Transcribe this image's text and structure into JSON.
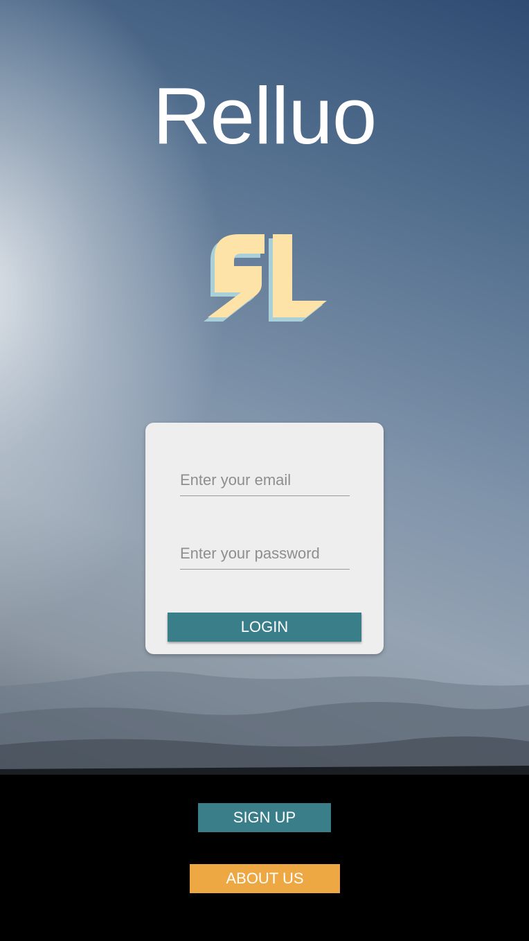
{
  "app": {
    "title": "Relluo"
  },
  "logo": {
    "icon": "relluo-sl-logo-icon",
    "colors": {
      "fill": "#fde3a7",
      "shadow": "#a9d0d8"
    }
  },
  "login_form": {
    "email_placeholder": "Enter your email",
    "password_placeholder": "Enter your password",
    "email_value": "",
    "password_value": "",
    "login_label": "LOGIN"
  },
  "actions": {
    "signup_label": "SIGN UP",
    "about_label": "ABOUT US"
  },
  "colors": {
    "primary": "#3a7e8a",
    "accent": "#eea843",
    "card": "#eeeeee"
  }
}
